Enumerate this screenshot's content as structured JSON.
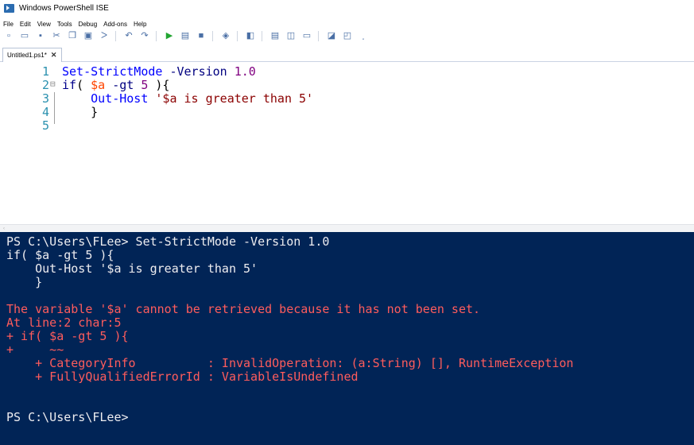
{
  "window": {
    "title": "Windows PowerShell ISE"
  },
  "menu": [
    "File",
    "Edit",
    "View",
    "Tools",
    "Debug",
    "Add-ons",
    "Help"
  ],
  "toolbar": {
    "icons": [
      "new-file-icon",
      "open-icon",
      "save-icon",
      "cut-icon",
      "copy-icon",
      "paste-icon",
      "run-selection-icon",
      "undo-icon",
      "redo-icon",
      "run-icon",
      "run-selection-icon",
      "stop-icon",
      "remote-icon",
      "powershell-icon",
      "show-script-pane-icon",
      "show-script-right-icon",
      "show-script-max-icon",
      "show-command-icon",
      "show-addon-icon",
      "overflow-icon"
    ],
    "accent": "#4a6fa5",
    "run_color": "#22a531"
  },
  "tab": {
    "label": "Untitled1.ps1*",
    "close_glyph": "✕"
  },
  "editor": {
    "lines": [
      {
        "n": "1",
        "tokens": [
          [
            "cmd",
            "Set-StrictMode"
          ],
          [
            "plain",
            " "
          ],
          [
            "param",
            "-Version"
          ],
          [
            "plain",
            " "
          ],
          [
            "num",
            "1.0"
          ]
        ]
      },
      {
        "n": "2",
        "tokens": [
          [
            "kw",
            "if"
          ],
          [
            "plain",
            "( "
          ],
          [
            "var",
            "$a"
          ],
          [
            "plain",
            " "
          ],
          [
            "param",
            "-gt"
          ],
          [
            "plain",
            " "
          ],
          [
            "num",
            "5"
          ],
          [
            "plain",
            " ){"
          ]
        ]
      },
      {
        "n": "3",
        "tokens": [
          [
            "plain",
            "    "
          ],
          [
            "cmd",
            "Out-Host"
          ],
          [
            "plain",
            " "
          ],
          [
            "str",
            "'$a is greater than 5'"
          ]
        ]
      },
      {
        "n": "4",
        "tokens": [
          [
            "plain",
            "    }"
          ]
        ]
      },
      {
        "n": "5",
        "tokens": []
      }
    ]
  },
  "console": {
    "background": "#012456",
    "lines": [
      {
        "t": "PS C:\\Users\\FLee> Set-StrictMode -Version 1.0",
        "err": false
      },
      {
        "t": "if( $a -gt 5 ){",
        "err": false
      },
      {
        "t": "    Out-Host '$a is greater than 5'",
        "err": false
      },
      {
        "t": "    }",
        "err": false
      },
      {
        "t": "",
        "err": false
      },
      {
        "t": "The variable '$a' cannot be retrieved because it has not been set.",
        "err": true
      },
      {
        "t": "At line:2 char:5",
        "err": true
      },
      {
        "t": "+ if( $a -gt 5 ){",
        "err": true
      },
      {
        "t": "+     ~~",
        "err": true
      },
      {
        "t": "    + CategoryInfo          : InvalidOperation: (a:String) [], RuntimeException",
        "err": true
      },
      {
        "t": "    + FullyQualifiedErrorId : VariableIsUndefined",
        "err": true
      },
      {
        "t": "",
        "err": false
      },
      {
        "t": "",
        "err": false
      },
      {
        "t": "PS C:\\Users\\FLee>",
        "err": false
      }
    ]
  }
}
